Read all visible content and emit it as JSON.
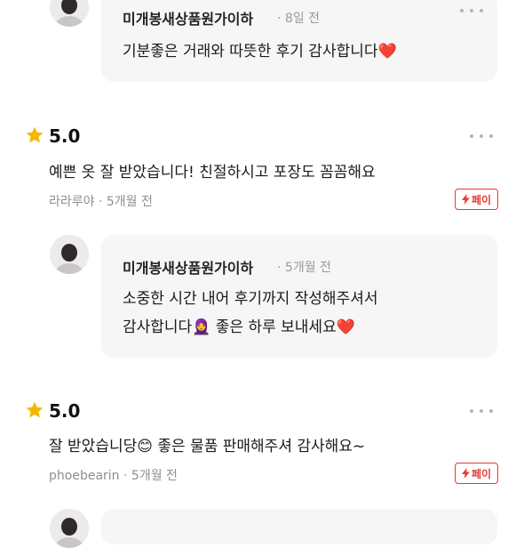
{
  "replies": [
    {
      "seller": "미개봉새상품원가이하",
      "time": "8일 전",
      "lines": [
        "기분좋은 거래와 따뜻한 후기 감사합니다"
      ],
      "line_ends": [
        "❤️"
      ]
    },
    {
      "seller": "미개봉새상품원가이하",
      "time": "5개월 전",
      "lines": [
        "소중한 시간 내어 후기까지 작성해주셔서",
        "감사합니다"
      ],
      "line2_mid_emoji": "🧕",
      "line2_tail": "좋은 하루 보내세요",
      "line2_end": "❤️"
    }
  ],
  "reviews": [
    {
      "rating": "5.0",
      "text": "예쁜 옷 잘 받았습니다! 친절하시고 포장도 꼼꼼해요",
      "reviewer": "라라루야",
      "time": "5개월 전",
      "badge": "페이"
    },
    {
      "rating": "5.0",
      "text_before_emoji": "잘 받았습니당",
      "emoji": "😊",
      "text_after_emoji": "좋은 물품 판매해주셔 감사해요~",
      "reviewer": "phoebearin",
      "time": "5개월 전",
      "badge": "페이"
    }
  ],
  "separator": "·",
  "icons": {
    "star": "star-icon",
    "more": "more-dots-icon",
    "bolt": "lightning-icon"
  },
  "colors": {
    "star": "#f5b800",
    "badge_red": "#e53935",
    "bubble_bg": "#f6f6f6",
    "muted_text": "#9a9a9a"
  }
}
